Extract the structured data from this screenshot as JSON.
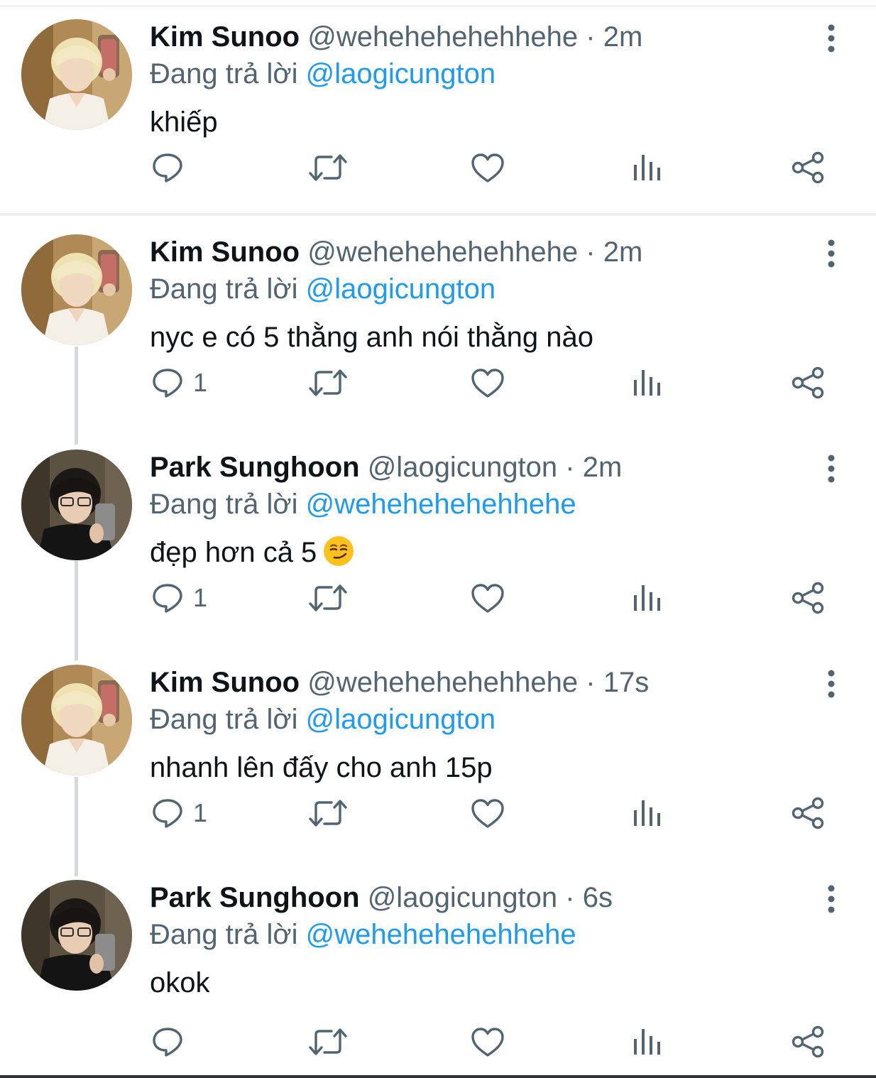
{
  "reply_prefix": "Đang trả lời",
  "tweets": [
    {
      "name": "Kim Sunoo",
      "handle": "@wehehehehehhehe",
      "separator": "·",
      "time": "2m",
      "reply_to": "@laogicungton",
      "text": "khiếp",
      "reply_count": "",
      "avatar": "blonde-avatar"
    },
    {
      "name": "Kim Sunoo",
      "handle": "@wehehehehehhehe",
      "separator": "·",
      "time": "2m",
      "reply_to": "@laogicungton",
      "text": "nyc e có 5 thằng anh nói thằng nào",
      "reply_count": "1",
      "avatar": "blonde-avatar"
    },
    {
      "name": "Park Sunghoon",
      "handle": "@laogicungton",
      "separator": "·",
      "time": "2m",
      "reply_to": "@wehehehehehhehe",
      "text": "đẹp hơn cả 5",
      "emoji": "smirking-face-emoji",
      "reply_count": "1",
      "avatar": "dark-hair-avatar"
    },
    {
      "name": "Kim Sunoo",
      "handle": "@wehehehehehhehe",
      "separator": "·",
      "time": "17s",
      "reply_to": "@laogicungton",
      "text": "nhanh lên đấy cho anh 15p",
      "reply_count": "1",
      "avatar": "blonde-avatar"
    },
    {
      "name": "Park Sunghoon",
      "handle": "@laogicungton",
      "separator": "·",
      "time": "6s",
      "reply_to": "@wehehehehehhehe",
      "text": "okok",
      "reply_count": "",
      "avatar": "dark-hair-avatar"
    }
  ],
  "colors": {
    "text_primary": "#0f1419",
    "text_secondary": "#536471",
    "mention": "#1d9bf0",
    "divider": "#eceef0",
    "thread_line": "#d5dadd"
  },
  "icons": [
    "reply-icon",
    "retweet-icon",
    "like-icon",
    "views-icon",
    "share-icon",
    "more-options-icon"
  ]
}
